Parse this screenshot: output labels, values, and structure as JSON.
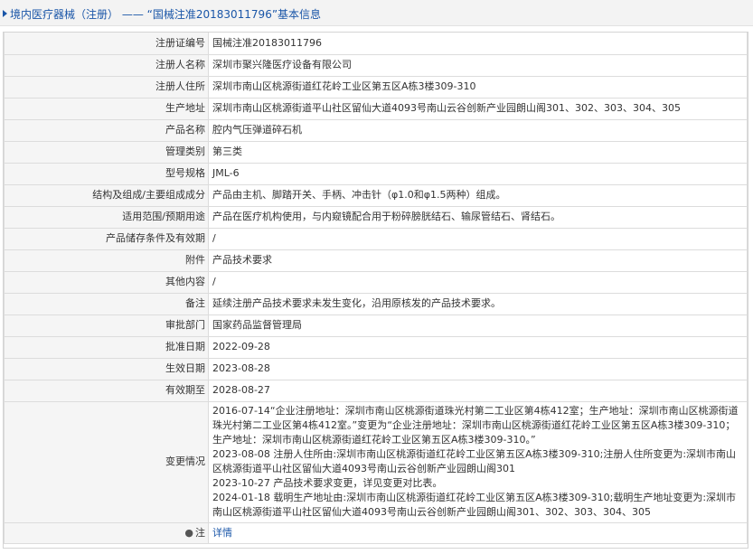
{
  "header": {
    "title": "境内医疗器械（注册） —— “国械注准20183011796”基本信息"
  },
  "rows": [
    {
      "label": "注册证编号",
      "value": "国械注准20183011796"
    },
    {
      "label": "注册人名称",
      "value": "深圳市聚兴隆医疗设备有限公司"
    },
    {
      "label": "注册人住所",
      "value": "深圳市南山区桃源街道红花岭工业区第五区A栋3楼309-310"
    },
    {
      "label": "生产地址",
      "value": "深圳市南山区桃源街道平山社区留仙大道4093号南山云谷创新产业园朗山阁301、302、303、304、305"
    },
    {
      "label": "产品名称",
      "value": "腔内气压弹道碎石机"
    },
    {
      "label": "管理类别",
      "value": "第三类"
    },
    {
      "label": "型号规格",
      "value": "JML-6"
    },
    {
      "label": "结构及组成/主要组成成分",
      "value": "产品由主机、脚踏开关、手柄、冲击针（φ1.0和φ1.5两种）组成。"
    },
    {
      "label": "适用范围/预期用途",
      "value": "产品在医疗机构使用，与内窥镜配合用于粉碎膀胱结石、输尿管结石、肾结石。"
    },
    {
      "label": "产品储存条件及有效期",
      "value": "/"
    },
    {
      "label": "附件",
      "value": "产品技术要求"
    },
    {
      "label": "其他内容",
      "value": "/"
    },
    {
      "label": "备注",
      "value": "延续注册产品技术要求未发生变化，沿用原核发的产品技术要求。"
    },
    {
      "label": "审批部门",
      "value": "国家药品监督管理局"
    },
    {
      "label": "批准日期",
      "value": "2022-09-28"
    },
    {
      "label": "生效日期",
      "value": "2023-08-28"
    },
    {
      "label": "有效期至",
      "value": "2028-08-27"
    }
  ],
  "change": {
    "label": "变更情况",
    "value": "2016-07-14“企业注册地址：深圳市南山区桃源街道珠光村第二工业区第4栋412室；生产地址：深圳市南山区桃源街道珠光村第二工业区第4栋412室。”变更为“企业注册地址：深圳市南山区桃源街道红花岭工业区第五区A栋3楼309-310；生产地址：深圳市南山区桃源街道红花岭工业区第五区A栋3楼309-310。”\n2023-08-08 注册人住所由:深圳市南山区桃源街道红花岭工业区第五区A栋3楼309-310;注册人住所变更为:深圳市南山区桃源街道平山社区留仙大道4093号南山云谷创新产业园朗山阁301\n2023-10-27 产品技术要求变更，详见变更对比表。\n2024-01-18 载明生产地址由:深圳市南山区桃源街道红花岭工业区第五区A栋3楼309-310;载明生产地址变更为:深圳市南山区桃源街道平山社区留仙大道4093号南山云谷创新产业园朗山阁301、302、303、304、305"
  },
  "note": {
    "icon": "location-pin-icon",
    "label": "注",
    "link_text": "详情"
  }
}
